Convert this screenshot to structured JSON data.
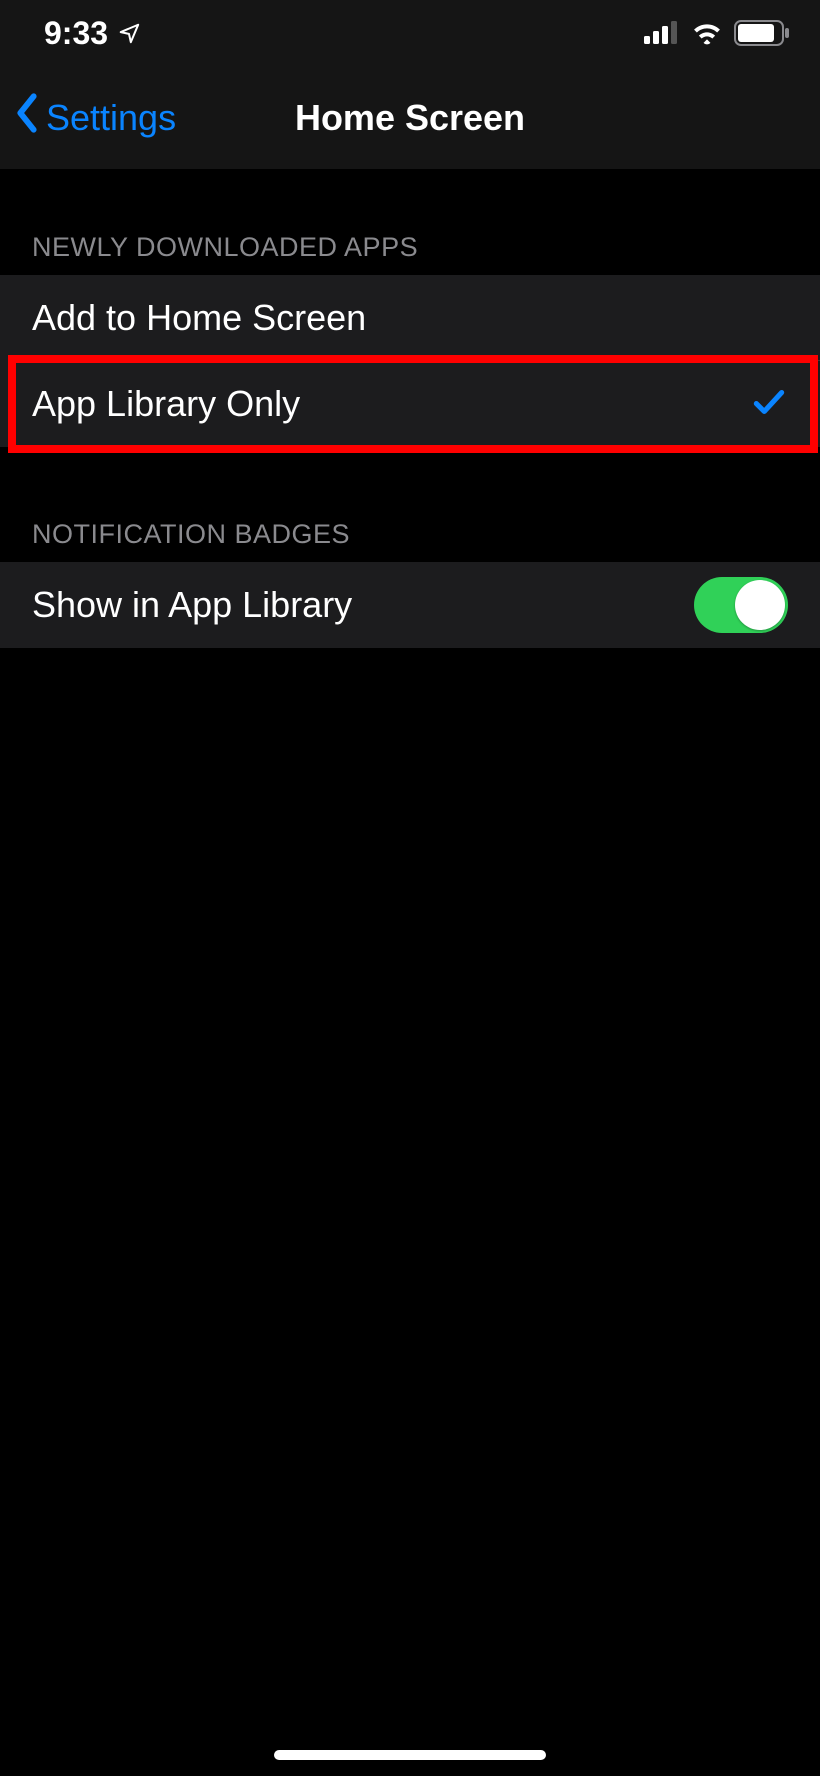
{
  "status_bar": {
    "time": "9:33"
  },
  "nav": {
    "back_label": "Settings",
    "title": "Home Screen"
  },
  "sections": {
    "newly_downloaded_apps": {
      "header": "Newly Downloaded Apps",
      "options": [
        {
          "label": "Add to Home Screen",
          "selected": false
        },
        {
          "label": "App Library Only",
          "selected": true
        }
      ]
    },
    "notification_badges": {
      "header": "Notification Badges",
      "rows": [
        {
          "label": "Show in App Library",
          "toggle_on": true
        }
      ]
    }
  }
}
